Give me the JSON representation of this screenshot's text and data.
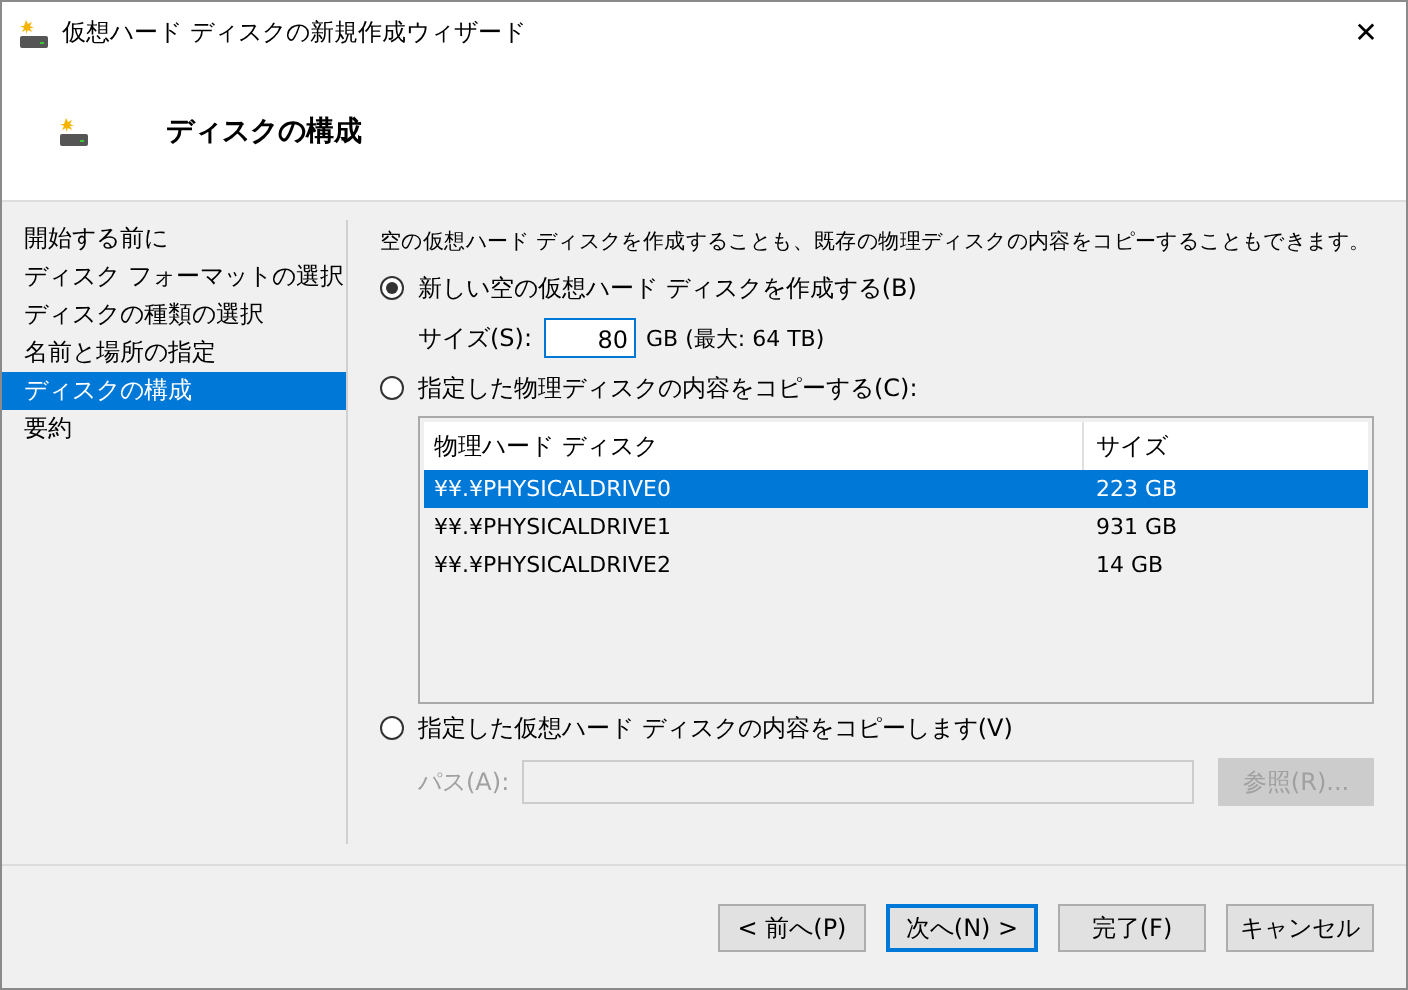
{
  "window": {
    "title": "仮想ハード ディスクの新規作成ウィザード",
    "close": "✕"
  },
  "header": {
    "title": "ディスクの構成"
  },
  "steps": [
    {
      "label": "開始する前に",
      "selected": false
    },
    {
      "label": "ディスク フォーマットの選択",
      "selected": false
    },
    {
      "label": "ディスクの種類の選択",
      "selected": false
    },
    {
      "label": "名前と場所の指定",
      "selected": false
    },
    {
      "label": "ディスクの構成",
      "selected": true
    },
    {
      "label": "要約",
      "selected": false
    }
  ],
  "description": "空の仮想ハード ディスクを作成することも、既存の物理ディスクの内容をコピーすることもできます。",
  "options": [
    {
      "kind": "size",
      "label": "新しい空の仮想ハード ディスクを作成する(B)",
      "selected": true,
      "field_label": "サイズ(S):",
      "value": "80",
      "unit": "GB (最大: 64 TB)"
    },
    {
      "kind": "disk_table",
      "label": "指定した物理ディスクの内容をコピーする(C):",
      "selected": false,
      "columns": [
        "物理ハード ディスク",
        "サイズ"
      ],
      "rows": [
        {
          "cells": [
            "¥¥.¥PHYSICALDRIVE0",
            "223 GB"
          ],
          "selected": true
        },
        {
          "cells": [
            "¥¥.¥PHYSICALDRIVE1",
            "931 GB"
          ],
          "selected": false
        },
        {
          "cells": [
            "¥¥.¥PHYSICALDRIVE2",
            "14 GB"
          ],
          "selected": false
        }
      ]
    },
    {
      "kind": "path",
      "label": "指定した仮想ハード ディスクの内容をコピーします(V)",
      "selected": false,
      "field_label": "パス(A):",
      "disabled": true,
      "browse": "参照(R)..."
    }
  ],
  "buttons": [
    {
      "label": "< 前へ(P)",
      "default": false
    },
    {
      "label": "次へ(N) >",
      "default": true
    },
    {
      "label": "完了(F)",
      "default": false
    },
    {
      "label": "キャンセル",
      "default": false
    }
  ]
}
